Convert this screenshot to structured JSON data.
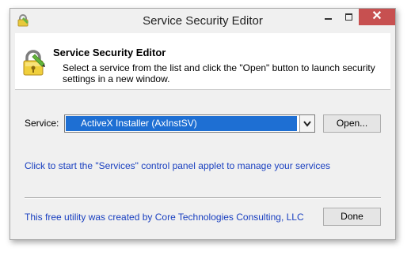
{
  "window": {
    "title": "Service Security Editor"
  },
  "header": {
    "title": "Service Security Editor",
    "description": "Select a service from the list and click the \"Open\" button to launch security settings in a new window."
  },
  "service": {
    "label": "Service:",
    "selected": "ActiveX Installer (AxInstSV)"
  },
  "buttons": {
    "open": "Open...",
    "done": "Done"
  },
  "link_text": "Click to start the \"Services\" control panel applet to manage your services",
  "footer_text": "This free utility was created by Core Technologies Consulting, LLC",
  "colors": {
    "selection": "#1e6fd3",
    "link": "#1a40c0",
    "close_button": "#c75050"
  },
  "icons": {
    "app": "lock-icon",
    "header": "lock-icon",
    "dropdown": "chevron-down-icon",
    "close": "close-icon",
    "minimize": "minimize-icon",
    "maximize": "maximize-icon"
  }
}
